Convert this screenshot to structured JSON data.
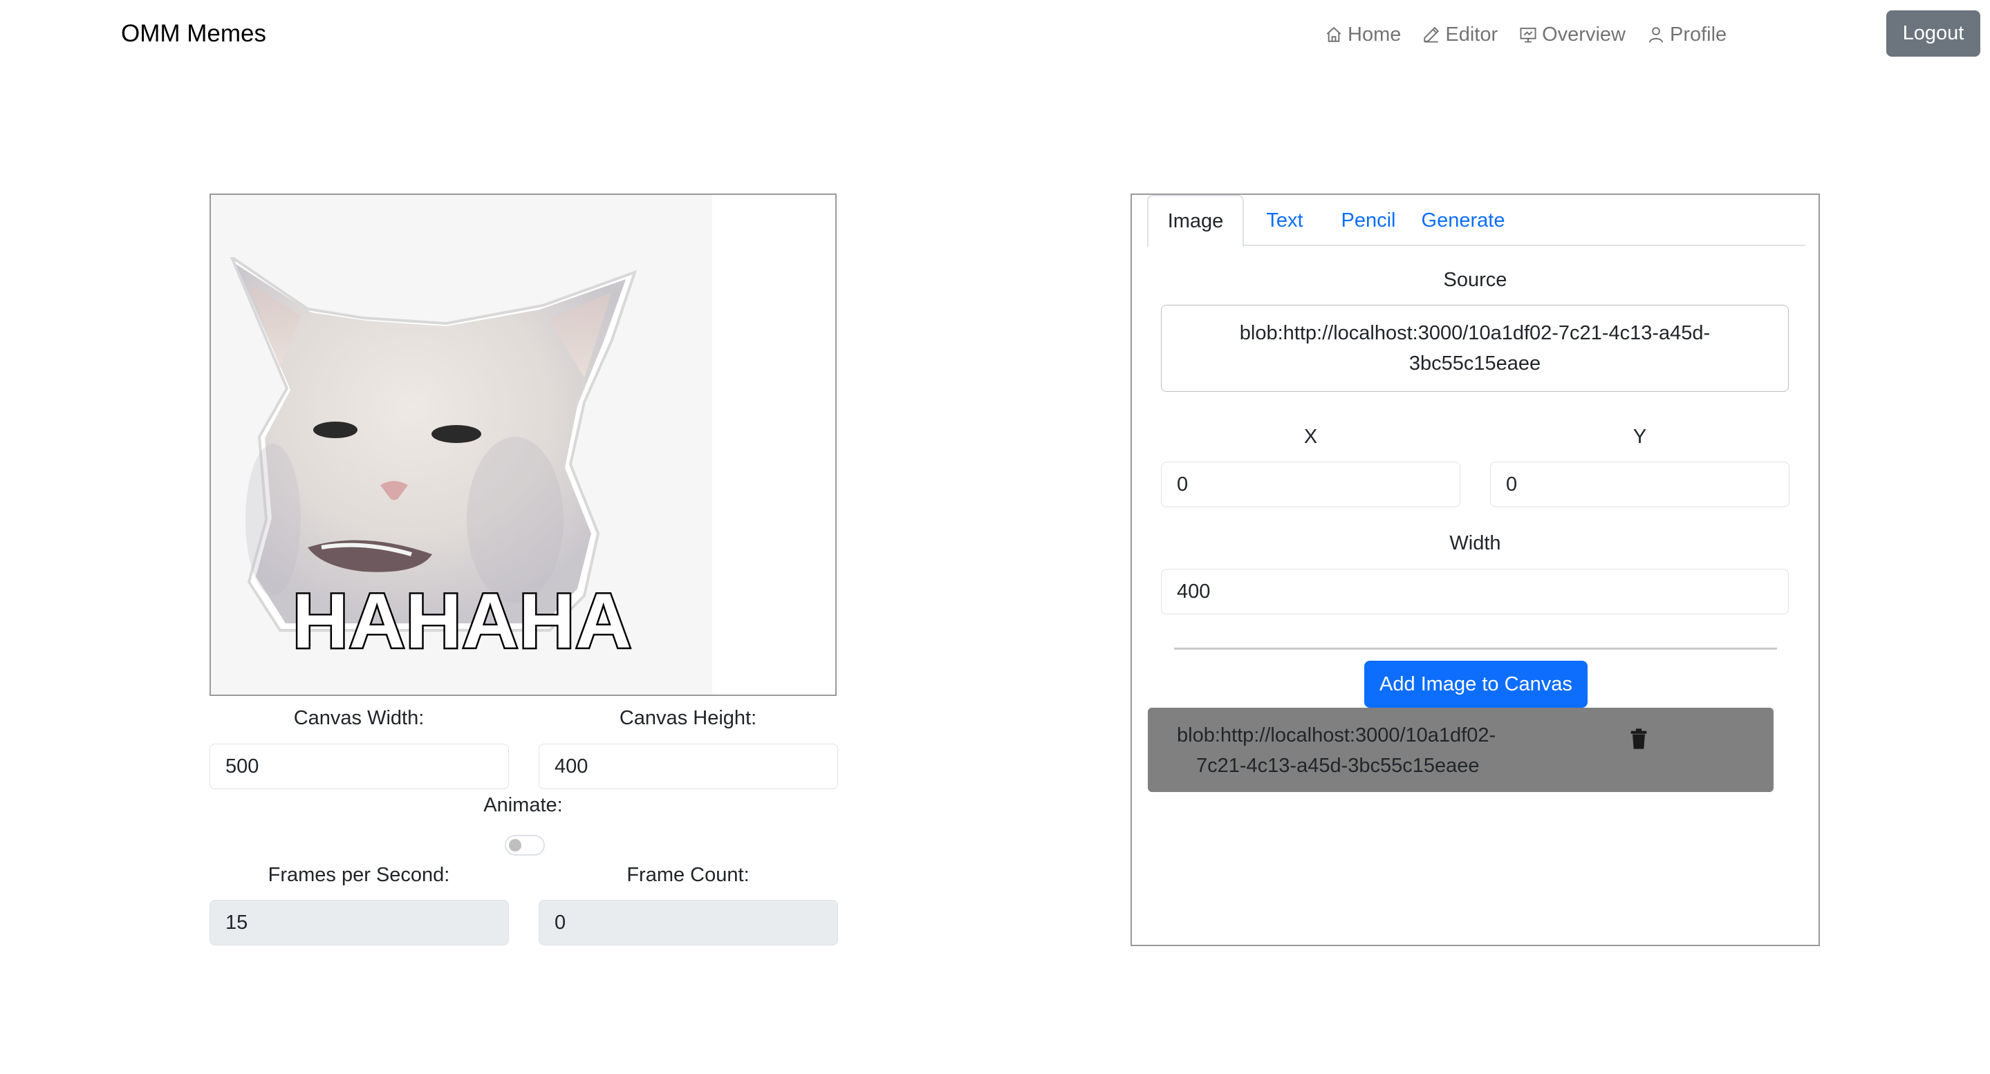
{
  "navbar": {
    "brand": "OMM Memes",
    "links": [
      {
        "label": "Home",
        "icon": "house-icon"
      },
      {
        "label": "Editor",
        "icon": "pencil-icon"
      },
      {
        "label": "Overview",
        "icon": "presentation-icon"
      },
      {
        "label": "Profile",
        "icon": "person-icon"
      }
    ],
    "logout_label": "Logout"
  },
  "canvas": {
    "meme_text": "HAHAHA",
    "width_label": "Canvas Width:",
    "width_value": "500",
    "height_label": "Canvas Height:",
    "height_value": "400",
    "animate_label": "Animate:",
    "animate_on": false,
    "fps_label": "Frames per Second:",
    "fps_value": "15",
    "frame_count_label": "Frame Count:",
    "frame_count_value": "0"
  },
  "panel": {
    "tabs": [
      {
        "label": "Image",
        "active": true
      },
      {
        "label": "Text",
        "active": false
      },
      {
        "label": "Pencil",
        "active": false
      },
      {
        "label": "Generate",
        "active": false
      }
    ],
    "source_label": "Source",
    "source_value_line1": "blob:http://localhost:3000/10a1df02-7c21-4c13-a45d-",
    "source_value_line2": "3bc55c15eaee",
    "x_label": "X",
    "x_value": "0",
    "y_label": "Y",
    "y_value": "0",
    "width_label": "Width",
    "width_value": "400",
    "add_button_label": "Add Image to Canvas",
    "items": [
      {
        "line1": "blob:http://localhost:3000/10a1df02-",
        "line2": "7c21-4c13-a45d-3bc55c15eaee"
      }
    ]
  },
  "colors": {
    "primary": "#0d6efd",
    "secondary": "#6c757d",
    "list_item_bg": "#808080"
  }
}
